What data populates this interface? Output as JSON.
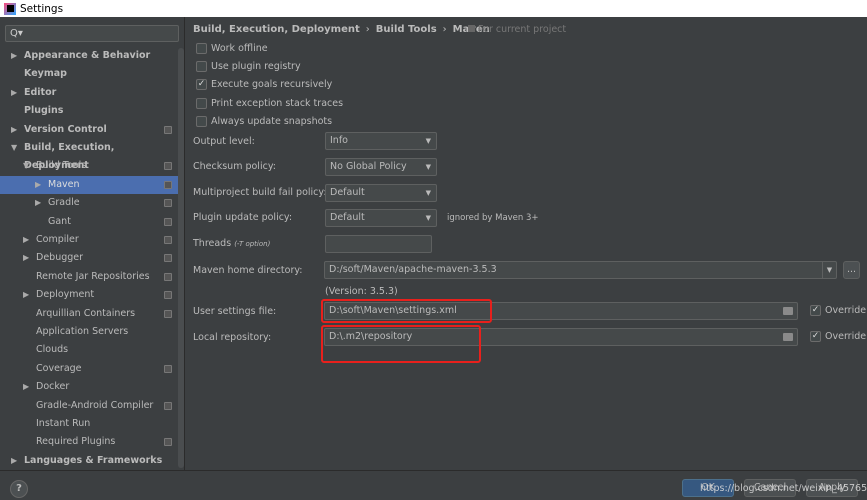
{
  "window": {
    "title": "Settings"
  },
  "search": {
    "placeholder": "Q▾"
  },
  "sidebar": {
    "items": [
      {
        "label": "Appearance & Behavior",
        "level": 0,
        "arrow": "right",
        "bold": true,
        "copy": false
      },
      {
        "label": "Keymap",
        "level": 0,
        "arrow": "",
        "bold": true,
        "copy": false
      },
      {
        "label": "Editor",
        "level": 0,
        "arrow": "right",
        "bold": true,
        "copy": false
      },
      {
        "label": "Plugins",
        "level": 0,
        "arrow": "",
        "bold": true,
        "copy": false
      },
      {
        "label": "Version Control",
        "level": 0,
        "arrow": "right",
        "bold": true,
        "copy": true
      },
      {
        "label": "Build, Execution, Deployment",
        "level": 0,
        "arrow": "down",
        "bold": true,
        "copy": false
      },
      {
        "label": "Build Tools",
        "level": 1,
        "arrow": "down",
        "copy": true
      },
      {
        "label": "Maven",
        "level": 2,
        "arrow": "right",
        "copy": true,
        "selected": true
      },
      {
        "label": "Gradle",
        "level": 2,
        "arrow": "right",
        "copy": true
      },
      {
        "label": "Gant",
        "level": 2,
        "arrow": "",
        "copy": true
      },
      {
        "label": "Compiler",
        "level": 1,
        "arrow": "right",
        "copy": true
      },
      {
        "label": "Debugger",
        "level": 1,
        "arrow": "right",
        "copy": true
      },
      {
        "label": "Remote Jar Repositories",
        "level": 1,
        "arrow": "",
        "copy": true
      },
      {
        "label": "Deployment",
        "level": 1,
        "arrow": "right",
        "copy": true
      },
      {
        "label": "Arquillian Containers",
        "level": 1,
        "arrow": "",
        "copy": true
      },
      {
        "label": "Application Servers",
        "level": 1,
        "arrow": "",
        "copy": false
      },
      {
        "label": "Clouds",
        "level": 1,
        "arrow": "",
        "copy": false
      },
      {
        "label": "Coverage",
        "level": 1,
        "arrow": "",
        "copy": true
      },
      {
        "label": "Docker",
        "level": 1,
        "arrow": "right",
        "copy": false
      },
      {
        "label": "Gradle-Android Compiler",
        "level": 1,
        "arrow": "",
        "copy": true
      },
      {
        "label": "Instant Run",
        "level": 1,
        "arrow": "",
        "copy": false
      },
      {
        "label": "Required Plugins",
        "level": 1,
        "arrow": "",
        "copy": true
      },
      {
        "label": "Languages & Frameworks",
        "level": 0,
        "arrow": "right",
        "bold": true,
        "copy": false
      }
    ]
  },
  "breadcrumb": {
    "items": [
      "Build, Execution, Deployment",
      "Build Tools",
      "Maven"
    ],
    "sep": "›",
    "scope": "For current project"
  },
  "checkboxes": [
    {
      "label": "Work offline",
      "checked": false
    },
    {
      "label": "Use plugin registry",
      "checked": false
    },
    {
      "label": "Execute goals recursively",
      "checked": true
    },
    {
      "label": "Print exception stack traces",
      "checked": false
    },
    {
      "label": "Always update snapshots",
      "checked": false
    }
  ],
  "form": {
    "output_level": {
      "label": "Output level:",
      "value": "Info"
    },
    "checksum": {
      "label": "Checksum policy:",
      "value": "No Global Policy"
    },
    "multiproject": {
      "label": "Multiproject build fail policy:",
      "value": "Default"
    },
    "plugin_update": {
      "label": "Plugin update policy:",
      "value": "Default",
      "note": "ignored by Maven 3+"
    },
    "threads": {
      "label": "Threads",
      "hint": "(-T option)",
      "value": ""
    },
    "maven_home": {
      "label": "Maven home directory:",
      "value": "D:/soft/Maven/apache-maven-3.5.3",
      "browse": "...",
      "version": "(Version: 3.5.3)"
    },
    "user_settings": {
      "label": "User settings file:",
      "value": "D:\\soft\\Maven\\settings.xml",
      "override_label": "Override",
      "override": true
    },
    "local_repo": {
      "label": "Local repository:",
      "value": "D:\\.m2\\repository",
      "override_label": "Override",
      "override": true
    }
  },
  "footer": {
    "help": "?",
    "ok": "OK",
    "cancel": "Cancel",
    "apply": "Apply",
    "watermark": "https://blog.csdn.net/weixin_45765201"
  },
  "colors": {
    "highlight": "#e8201c",
    "selection": "#4b6eaf",
    "background": "#3c3f41"
  }
}
